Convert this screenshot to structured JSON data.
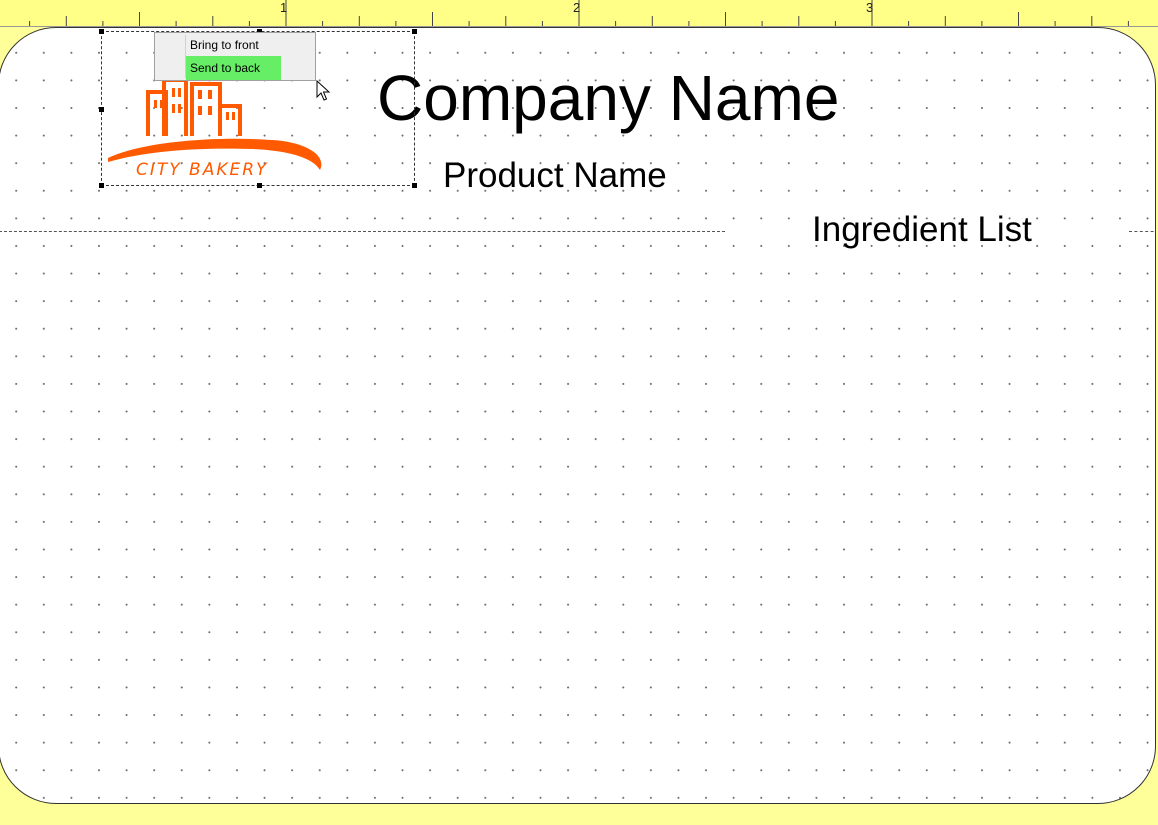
{
  "ruler": {
    "labels": [
      "1",
      "2",
      "3"
    ]
  },
  "label": {
    "company_name": "Company Name",
    "product_name": "Product Name",
    "ingredient_list": "Ingredient List"
  },
  "logo": {
    "text": "CITY BAKERY",
    "color": "#ff5a00",
    "icon": "city-bakery-logo"
  },
  "context_menu": {
    "items": [
      {
        "label": "Bring to front",
        "highlighted": false
      },
      {
        "label": "Send to back",
        "highlighted": true
      }
    ],
    "highlight_color": "#66ee66"
  },
  "colors": {
    "background": "#ffff99",
    "canvas": "#ffffff"
  }
}
